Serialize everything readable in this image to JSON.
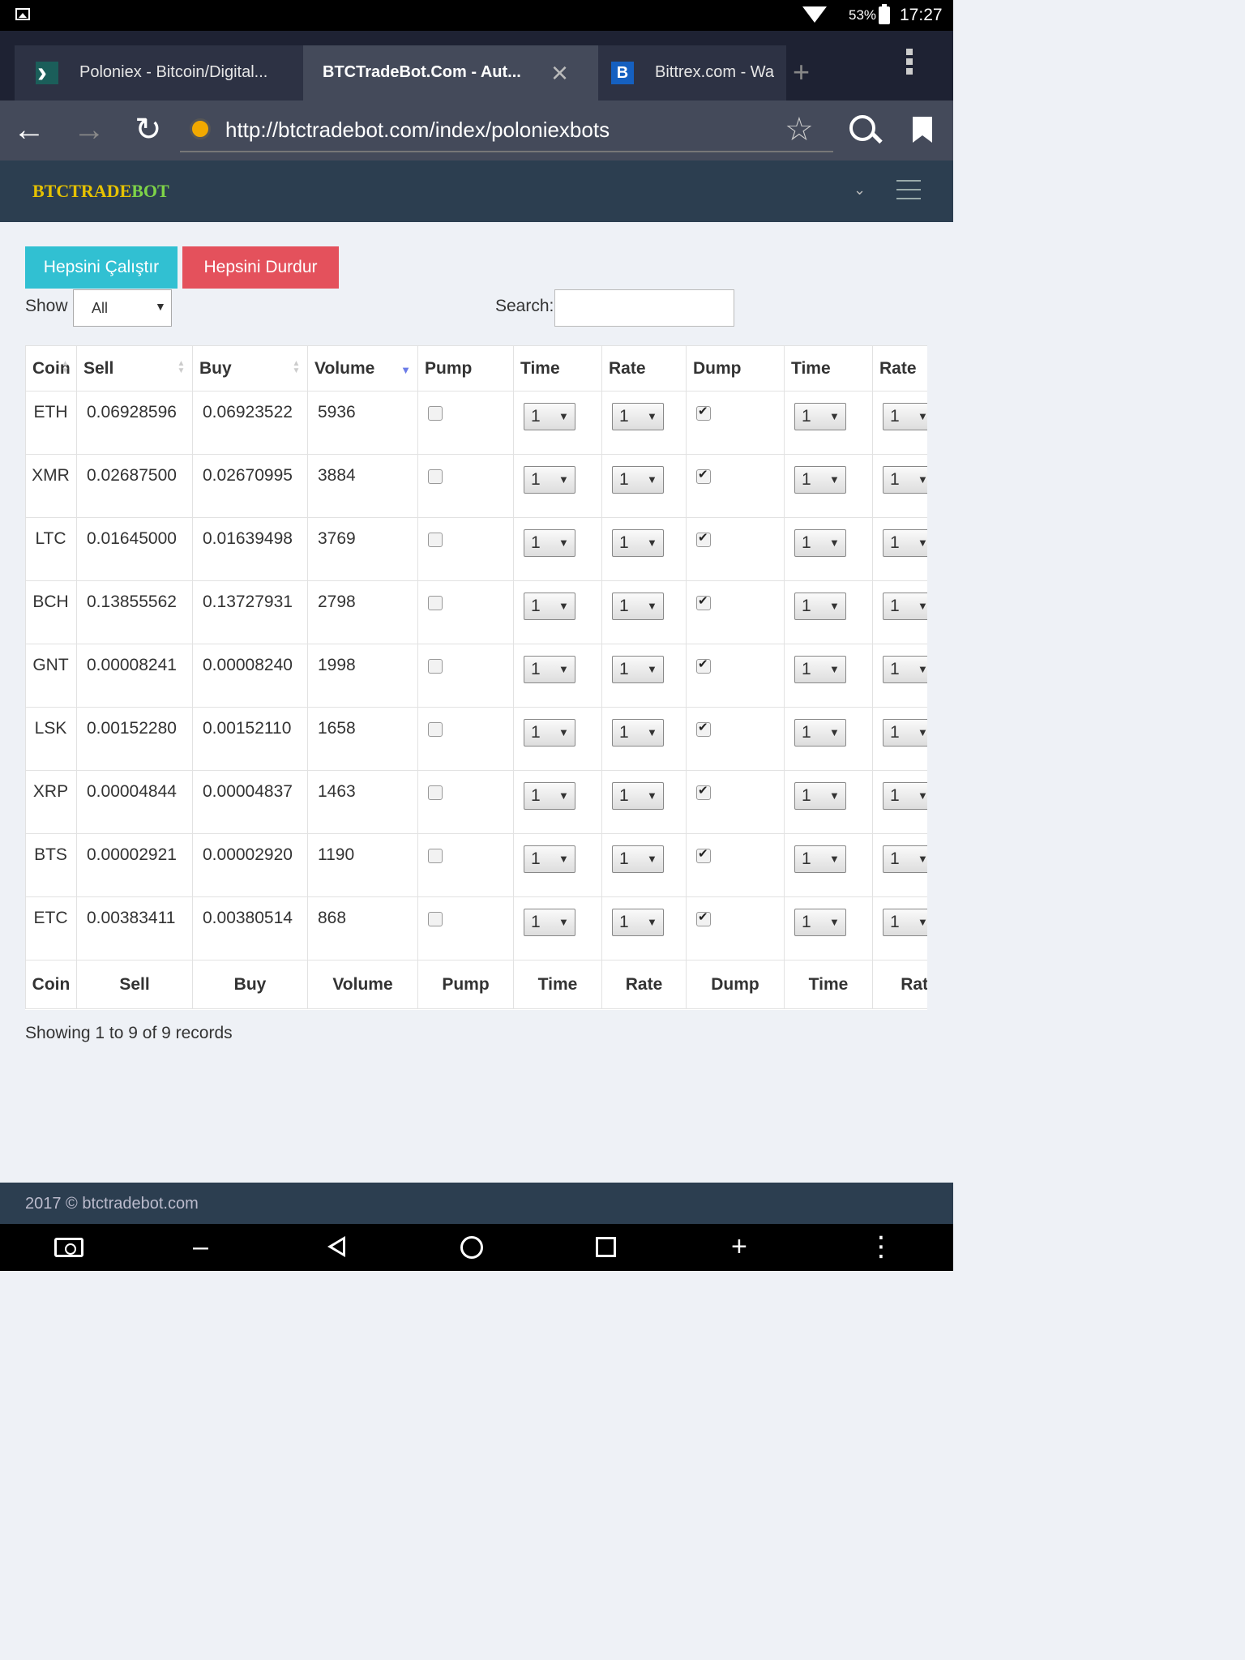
{
  "status": {
    "battery": "53%",
    "time": "17:27"
  },
  "tabs": [
    {
      "title": "Poloniex - Bitcoin/Digital...",
      "icon": "poloniex-favicon"
    },
    {
      "title": "BTCTradeBot.Com - Aut...",
      "icon": "none"
    },
    {
      "title": "Bittrex.com - Wa",
      "icon": "bittrex-favicon"
    }
  ],
  "browser": {
    "url": "http://btctradebot.com/index/poloniexbots"
  },
  "brand": {
    "part1": "BTCTRADE",
    "part2": "BOT",
    "color1": "#e6c200",
    "color2": "#7ed348"
  },
  "buttons": {
    "run_all": "Hepsini Çalıştır",
    "stop_all": "Hepsini Durdur",
    "run_color": "#31c0d2",
    "stop_color": "#e4515c"
  },
  "filter": {
    "show_label": "Show",
    "show_value": "All",
    "search_label": "Search:",
    "search_value": ""
  },
  "table": {
    "headers": [
      "Coin",
      "Sell",
      "Buy",
      "Volume",
      "Pump",
      "Time",
      "Rate",
      "Dump",
      "Time",
      "Rate"
    ],
    "rows": [
      {
        "coin": "ETH",
        "sell": "0.06928596",
        "buy": "0.06923522",
        "volume": "5936",
        "pump": false,
        "time1": "1",
        "rate1": "1",
        "dump": true,
        "time2": "1",
        "rate2": "1"
      },
      {
        "coin": "XMR",
        "sell": "0.02687500",
        "buy": "0.02670995",
        "volume": "3884",
        "pump": false,
        "time1": "1",
        "rate1": "1",
        "dump": true,
        "time2": "1",
        "rate2": "1"
      },
      {
        "coin": "LTC",
        "sell": "0.01645000",
        "buy": "0.01639498",
        "volume": "3769",
        "pump": false,
        "time1": "1",
        "rate1": "1",
        "dump": true,
        "time2": "1",
        "rate2": "1"
      },
      {
        "coin": "BCH",
        "sell": "0.13855562",
        "buy": "0.13727931",
        "volume": "2798",
        "pump": false,
        "time1": "1",
        "rate1": "1",
        "dump": true,
        "time2": "1",
        "rate2": "1"
      },
      {
        "coin": "GNT",
        "sell": "0.00008241",
        "buy": "0.00008240",
        "volume": "1998",
        "pump": false,
        "time1": "1",
        "rate1": "1",
        "dump": true,
        "time2": "1",
        "rate2": "1"
      },
      {
        "coin": "LSK",
        "sell": "0.00152280",
        "buy": "0.00152110",
        "volume": "1658",
        "pump": false,
        "time1": "1",
        "rate1": "1",
        "dump": true,
        "time2": "1",
        "rate2": "1"
      },
      {
        "coin": "XRP",
        "sell": "0.00004844",
        "buy": "0.00004837",
        "volume": "1463",
        "pump": false,
        "time1": "1",
        "rate1": "1",
        "dump": true,
        "time2": "1",
        "rate2": "1"
      },
      {
        "coin": "BTS",
        "sell": "0.00002921",
        "buy": "0.00002920",
        "volume": "1190",
        "pump": false,
        "time1": "1",
        "rate1": "1",
        "dump": true,
        "time2": "1",
        "rate2": "1"
      },
      {
        "coin": "ETC",
        "sell": "0.00383411",
        "buy": "0.00380514",
        "volume": "868",
        "pump": false,
        "time1": "1",
        "rate1": "1",
        "dump": true,
        "time2": "1",
        "rate2": "1"
      }
    ],
    "info": "Showing 1 to 9 of 9 records"
  },
  "footer": {
    "text": "2017 © btctradebot.com"
  }
}
